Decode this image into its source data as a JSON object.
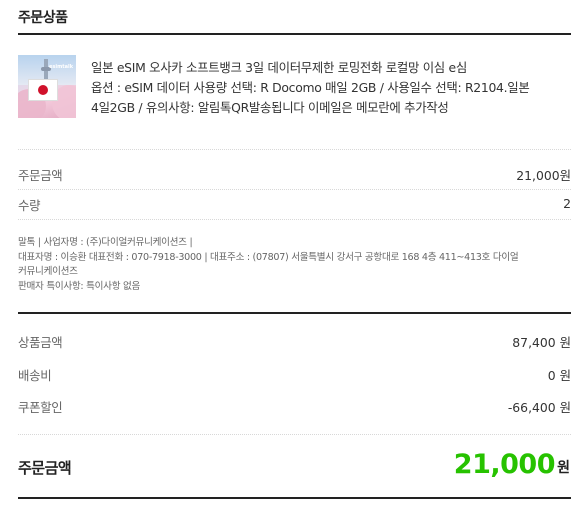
{
  "section": {
    "title": "주문상품"
  },
  "product": {
    "thumbnail_icon": "japan-esim-product-image",
    "thumbnail_text": "esimtalk",
    "line1": "일본 eSIM 오사카 소프트뱅크 3일 데이터무제한 로밍전화 로컬망 이심 e심",
    "line2": "옵션 : eSIM 데이터 사용량 선택: R Docomo 매일 2GB / 사용일수 선택: R2104.일본",
    "line3": "4일2GB / 유의사항: 알림톡QR발송됩니다 이메일은 메모란에 추가작성"
  },
  "order_summary": {
    "amount_label": "주문금액",
    "amount_value": "21,000원",
    "qty_label": "수량",
    "qty_value": "2"
  },
  "seller": {
    "line1": "말톡 | 사업자명 : (주)다이얼커뮤니케이션즈 |",
    "line2": "대표자명 : 이승환 대표전화 : 070-7918-3000 | 대표주소 : (07807) 서울특별시 강서구 공항대로 168 4층 411~413호 다이얼",
    "line3": "커뮤니케이션즈",
    "line4": "판매자 특이사항: 특이사항 없음"
  },
  "price_breakdown": {
    "product_label": "상품금액",
    "product_value": "87,400 원",
    "shipping_label": "배송비",
    "shipping_value": "0 원",
    "coupon_label": "쿠폰할인",
    "coupon_value": "-66,400 원"
  },
  "total": {
    "label": "주문금액",
    "value": "21,000",
    "unit": "원"
  },
  "colors": {
    "accent_green": "#27c200",
    "text_dark": "#222222",
    "divider": "#222222"
  }
}
